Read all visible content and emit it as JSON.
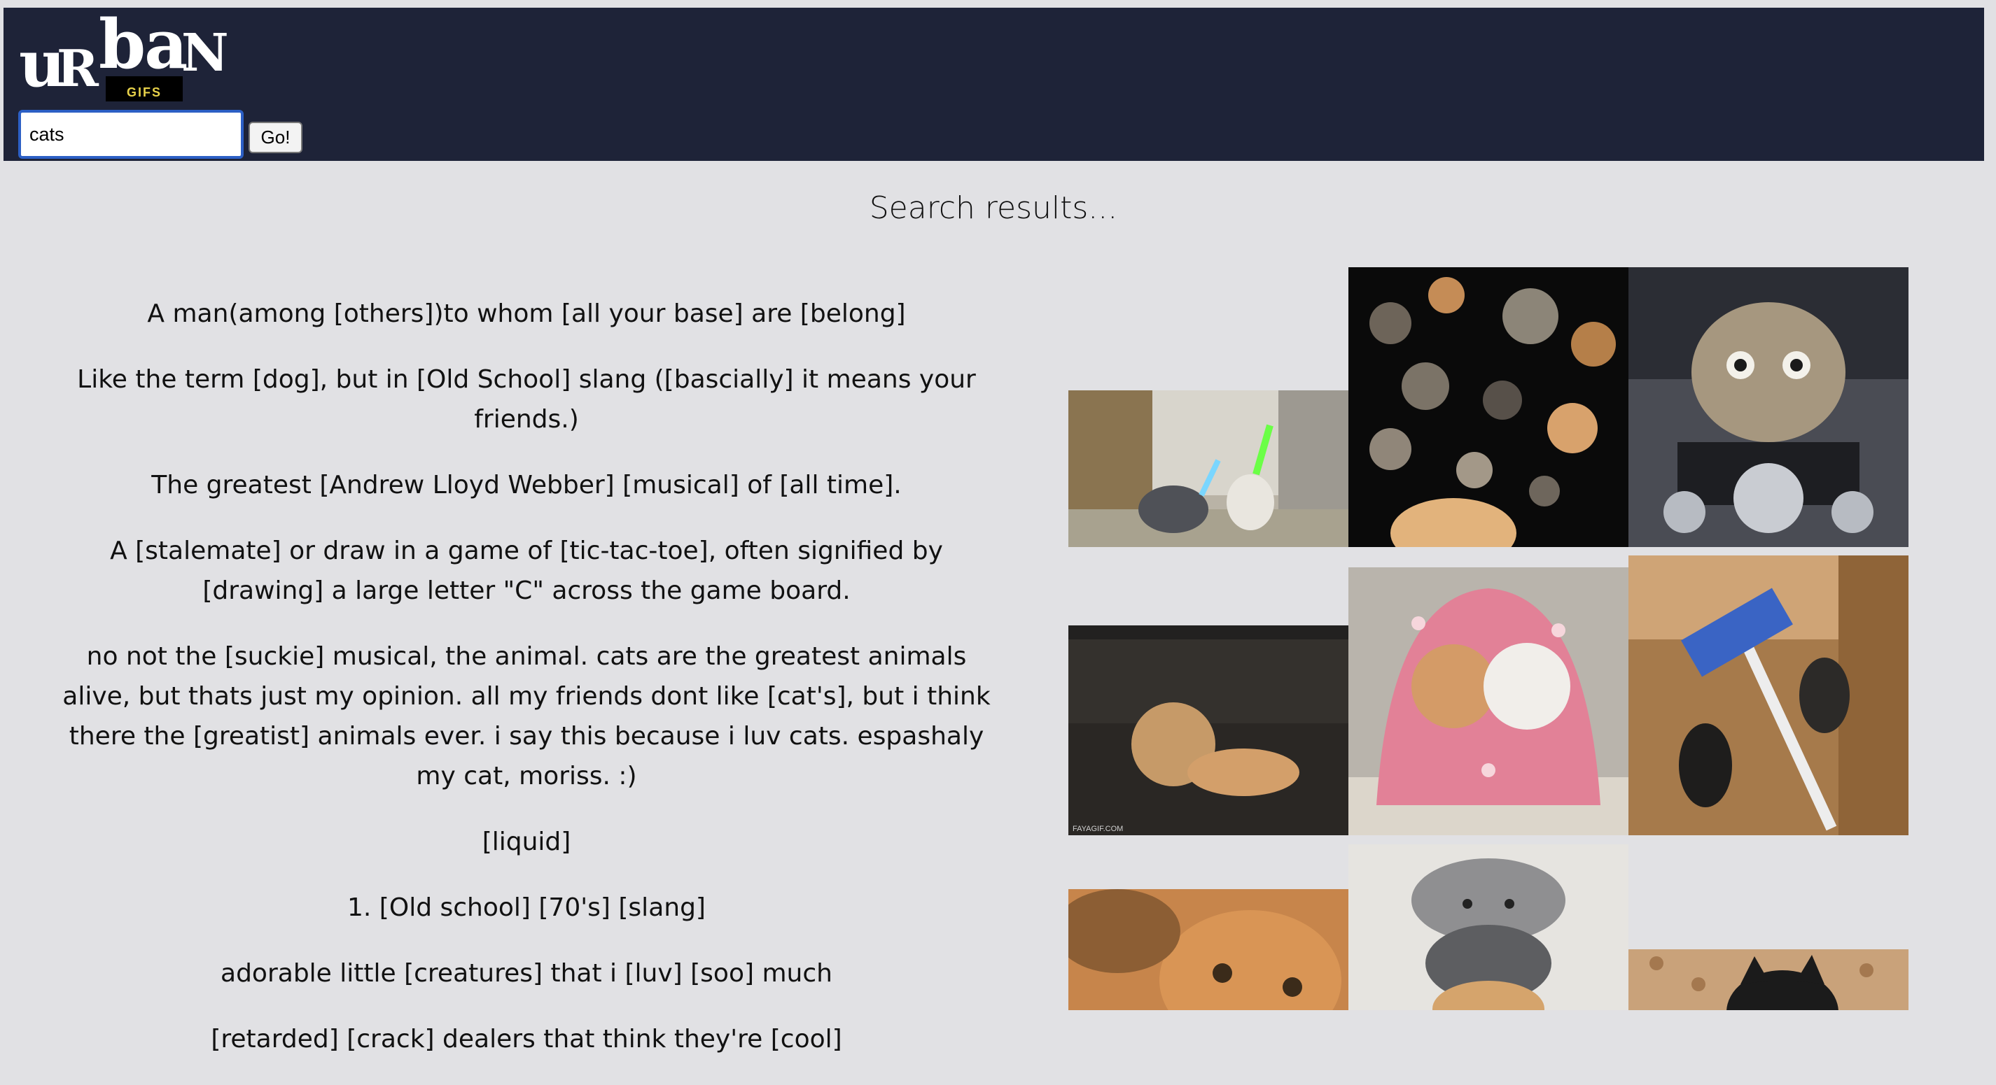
{
  "logo": {
    "text": "urban",
    "sub_text": "GIFS"
  },
  "search": {
    "value": "cats",
    "go_label": "Go!"
  },
  "results_title": "Search results...",
  "definitions": [
    "A man(among [others])to whom [all your base] are [belong]",
    "Like the term [dog], but in [Old School] slang ([bascially] it means your friends.)",
    "The greatest [Andrew Lloyd Webber] [musical] of [all time].",
    "A [stalemate] or draw in a game of [tic-tac-toe], often signified by [drawing] a large letter \"C\" across the game board.",
    "no not the [suckie] musical, the animal. cats are the greatest animals alive, but thats just my opinion. all my friends dont like [cat's], but i think there the [greatist] animals ever. i say this because i luv cats. espashaly my cat, moriss. :)",
    "[liquid]",
    "1. [Old school] [70's] [slang]",
    "adorable little [creatures] that i [luv] [soo] much",
    "[retarded] [crack] dealers that think they're [cool]"
  ],
  "gifs": [
    {
      "name": "gif-lightsaber-cats",
      "watermark": ""
    },
    {
      "name": "gif-floating-cat-heads",
      "watermark": ""
    },
    {
      "name": "gif-motorcycle-cat",
      "watermark": ""
    },
    {
      "name": "gif-kittens-on-couch",
      "watermark": "FAYAGIF.COM"
    },
    {
      "name": "gif-cats-in-pink-hoodie",
      "watermark": ""
    },
    {
      "name": "gif-cats-with-swiffer",
      "watermark": ""
    },
    {
      "name": "gif-orange-cat-closeup",
      "watermark": ""
    },
    {
      "name": "gif-stacked-cats",
      "watermark": ""
    },
    {
      "name": "gif-black-cat-peeking",
      "watermark": ""
    }
  ]
}
